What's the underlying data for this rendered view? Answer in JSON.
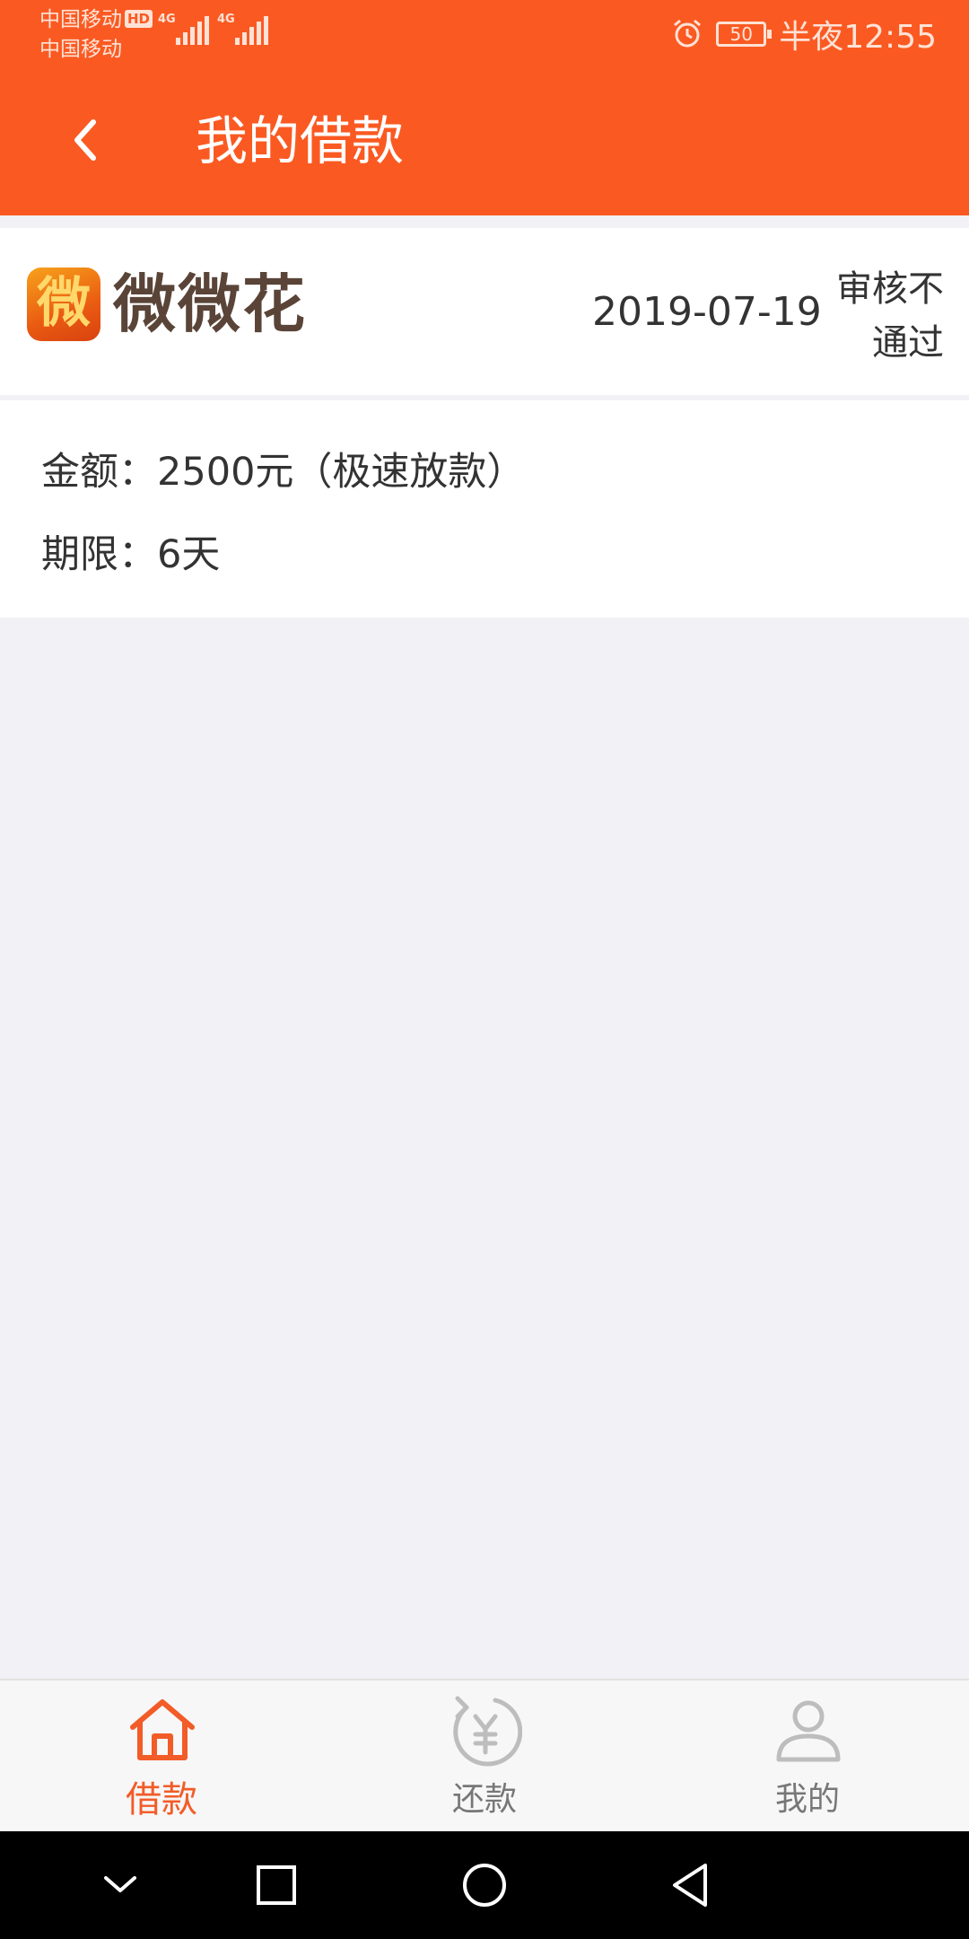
{
  "status_bar": {
    "carrier_1": "中国移动",
    "hd_badge": "HD",
    "carrier_2": "中国移动",
    "signal_1_label": "4G",
    "signal_2_label": "4G",
    "battery": "50",
    "time": "半夜12:55"
  },
  "header": {
    "title": "我的借款"
  },
  "loan": {
    "logo_glyph": "微",
    "brand": "微微花",
    "date": "2019-07-19",
    "status": "审核不通过",
    "amount_label": "金额：",
    "amount_value": "2500元（极速放款）",
    "term_label": "期限：",
    "term_value": "6天"
  },
  "tabbar": {
    "tabs": [
      {
        "label": "借款",
        "icon": "home-icon",
        "active": true
      },
      {
        "label": "还款",
        "icon": "repay-yen-icon",
        "active": false
      },
      {
        "label": "我的",
        "icon": "user-icon",
        "active": false
      }
    ]
  },
  "colors": {
    "brand_orange": "#fa5a22",
    "active_tab": "#f25c28",
    "inactive_tab": "#777777",
    "page_bg": "#f2f2f6"
  }
}
